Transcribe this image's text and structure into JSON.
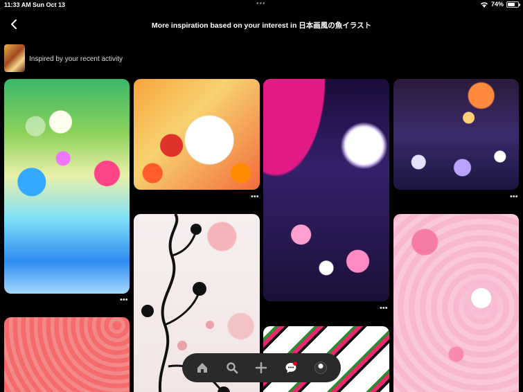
{
  "status_bar": {
    "time": "11:33 AM",
    "date": "Sun Oct 13",
    "dots": "•••",
    "battery_percent": "74%",
    "battery_level": 0.74
  },
  "header": {
    "title": "More inspiration based on your interest in 日本画風の魚イラスト"
  },
  "activity": {
    "label": "Inspired by your recent activity"
  },
  "pins": [
    {
      "more": "•••"
    },
    {
      "more": "•••"
    },
    {
      "more": "•••"
    },
    {
      "more": "•••"
    }
  ],
  "tab_bar": {
    "items": [
      "home-icon",
      "search-icon",
      "plus-icon",
      "messages-icon",
      "profile-avatar"
    ],
    "accent": "#e60023"
  }
}
